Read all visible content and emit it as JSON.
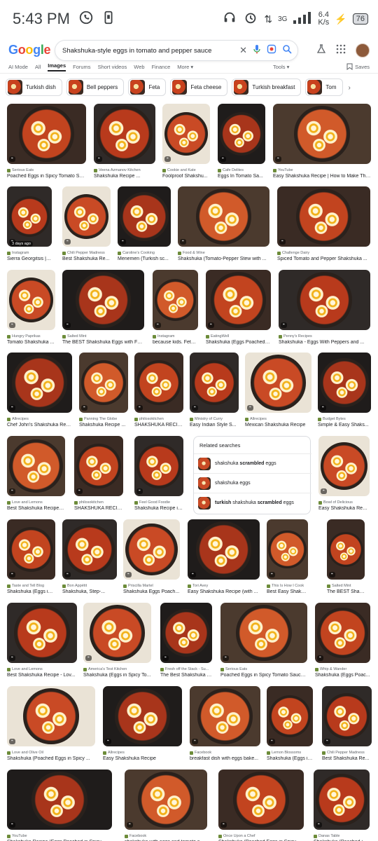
{
  "status": {
    "time": "5:43 PM",
    "net_rate": "6.4",
    "net_unit": "K/s",
    "signal_label": "3G",
    "battery": "76"
  },
  "header": {
    "logo": "Google",
    "query": "Shakshuka-style eggs in tomato and pepper sauce"
  },
  "tabs": {
    "items": [
      "AI Mode",
      "All",
      "Images",
      "Forums",
      "Short videos",
      "Web",
      "Finance",
      "More ▾"
    ],
    "active": "Images",
    "tools": "Tools ▾",
    "saves": "Saves"
  },
  "chips": [
    "Turkish dish",
    "Bell peppers",
    "Feta",
    "Feta cheese",
    "Turkish breakfast",
    "Tom"
  ],
  "results": [
    {
      "source": "Serious Eats",
      "title": "Poached Eggs in Spicy Tomato Sa..."
    },
    {
      "source": "Veena Azmanov Kitchen",
      "title": "Shakshuka Recipe ..."
    },
    {
      "source": "Cookie and Kate",
      "title": "Foolproof Shakshu..."
    },
    {
      "source": "Cafe Delites",
      "title": "Eggs In Tomato Sa..."
    },
    {
      "source": "YouTube",
      "title": "Easy Shakshuka Recipe | How to Make The..."
    },
    {
      "source": "Instagram",
      "title": "Sierra Georgitsis | C..."
    },
    {
      "source": "Chili Pepper Madness",
      "title": "Best Shakshuka Re..."
    },
    {
      "source": "Caroline's Cooking",
      "title": "Menemen (Turkish sc..."
    },
    {
      "source": "Food & Wine",
      "title": "Shakshuka (Tomato-Pepper Stew with ..."
    },
    {
      "source": "Challenge Dairy",
      "title": "Spiced Tomato and Pepper Shakshuka ..."
    },
    {
      "source": "Hungry Paprikas",
      "title": "Tomato Shakshuka ..."
    },
    {
      "source": "Salted Mint",
      "title": "The BEST Shakshuka Eggs with Fet..."
    },
    {
      "source": "Instagram",
      "title": "because kids. Feta ..."
    },
    {
      "source": "EatingWell",
      "title": "Shakshuka (Eggs Poached i..."
    },
    {
      "source": "Penny's Recipes",
      "title": "Shakshuka - Eggs With Peppers and ..."
    },
    {
      "source": "Allrecipes",
      "title": "Chef John's Shakshuka Reci..."
    },
    {
      "source": "Panning The Globe",
      "title": "Shakshuka Recipe ..."
    },
    {
      "source": "philosokitchen",
      "title": "SHAKSHUKA RECIP..."
    },
    {
      "source": "Ministry of Curry",
      "title": "Easy Indian Style S..."
    },
    {
      "source": "Allrecipes",
      "title": "Mexican Shakshuka Recipe"
    },
    {
      "source": "Budget Bytes",
      "title": "Simple & Easy Shaks..."
    },
    {
      "source": "Love and Lemons",
      "title": "Best Shakshuka Recipe -..."
    },
    {
      "source": "philosokitchen",
      "title": "SHAKSHUKA RECIPE ..."
    },
    {
      "source": "Feel Good Foodie",
      "title": "Shakshuka Recipe in ..."
    },
    {
      "source": "Bowl of Delicious",
      "title": "Easy Shakshuka Recipe ..."
    },
    {
      "source": "Taste and Tell Blog",
      "title": "Shakshuka (Eggs in ..."
    },
    {
      "source": "Bon Appétit",
      "title": "Shakshuka, Step-..."
    },
    {
      "source": "Priscilla Martel",
      "title": "Shakshuka Eggs Poach..."
    },
    {
      "source": "Tori Avey",
      "title": "Easy Shakshuka Recipe (with ..."
    },
    {
      "source": "This Is How I Cook",
      "title": "Best Easy Shakshu..."
    },
    {
      "source": "Salted Mint",
      "title": "The BEST Shakshuk..."
    },
    {
      "source": "Love and Lemons",
      "title": "Best Shakshuka Recipe - Lov..."
    },
    {
      "source": "America's Test Kitchen",
      "title": "Shakshuka (Eggs in Spicy To..."
    },
    {
      "source": "Fresh off the Stack - Su...",
      "title": "The Best Shakshuka Y..."
    },
    {
      "source": "Serious Eats",
      "title": "Poached Eggs in Spicy Tomato Sauce..."
    },
    {
      "source": "Whip & Wander",
      "title": "Shakshuka (Eggs Poac..."
    },
    {
      "source": "Love and Olive Oil",
      "title": "Shakshuka (Poached Eggs in Spicy ..."
    },
    {
      "source": "Allrecipes",
      "title": "Easy Shakshuka Recipe"
    },
    {
      "source": "Facebook",
      "title": "breakfast dish with eggs bake..."
    },
    {
      "source": "Lemon Blossoms",
      "title": "Shakshuka (Eggs in..."
    },
    {
      "source": "Chili Pepper Madness",
      "title": "Best Shakshuka Re..."
    },
    {
      "source": "YouTube",
      "title": "Shakshuka Recipe (Eggs Poached in Spicy..."
    },
    {
      "source": "Facebook",
      "title": "shakshuka with eggs and tomato sauce..."
    },
    {
      "source": "Once Upon a Chef",
      "title": "Shakshuka (Poached Eggs in Spicy To..."
    },
    {
      "source": "Danas Table",
      "title": "Shakshuka (Poached in ..."
    }
  ],
  "related": {
    "title": "Related searches",
    "items": [
      {
        "pre": "shakshuka ",
        "bold": "scrambled",
        "post": " eggs"
      },
      {
        "pre": "shakshuka eggs",
        "bold": "",
        "post": ""
      },
      {
        "pre": "",
        "bold": "turkish",
        "post": " shakshuka ",
        "bold2": "scrambled",
        "post2": " eggs"
      }
    ]
  },
  "badges": {
    "days": "3 days ago",
    "tori_avey": "Tori Avey",
    "quick_easy": "QUICK AND EASY"
  }
}
